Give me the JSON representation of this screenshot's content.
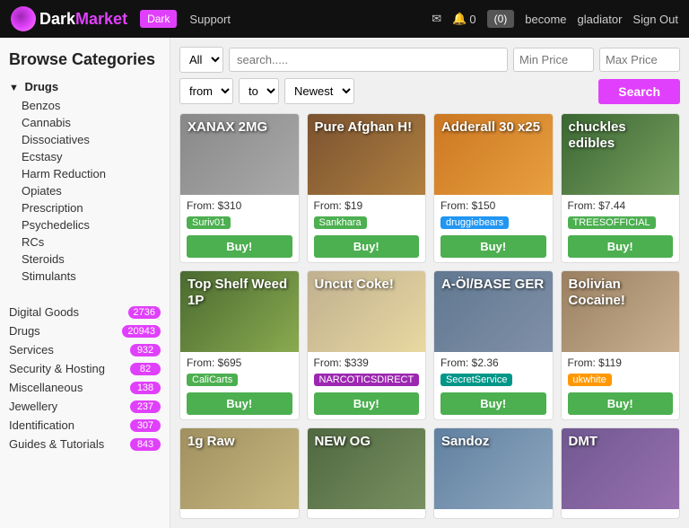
{
  "header": {
    "logo_dark": "Dark",
    "logo_market": "Market",
    "dark_btn": "Dark",
    "support_link": "Support",
    "become_link": "become",
    "user_link": "gladiator",
    "signout_link": "Sign Out",
    "msg_icon": "✉",
    "bell_icon": "🔔",
    "bell_count": "0",
    "cart_btn": "(0)"
  },
  "sidebar": {
    "title": "Browse Categories",
    "drugs_section": "Drugs",
    "sub_items": [
      "Benzos",
      "Cannabis",
      "Dissociatives",
      "Ecstasy",
      "Harm Reduction",
      "Opiates",
      "Prescription",
      "Psychedelics",
      "RCs",
      "Steroids",
      "Stimulants"
    ],
    "categories": [
      {
        "label": "Digital Goods",
        "count": "2736"
      },
      {
        "label": "Drugs",
        "count": "20943"
      },
      {
        "label": "Services",
        "count": "932"
      },
      {
        "label": "Security & Hosting",
        "count": "82"
      },
      {
        "label": "Miscellaneous",
        "count": "138"
      },
      {
        "label": "Jewellery",
        "count": "237"
      },
      {
        "label": "Identification",
        "count": "307"
      },
      {
        "label": "Guides & Tutorials",
        "count": "843"
      }
    ]
  },
  "search": {
    "category_default": "All",
    "search_placeholder": "search.....",
    "min_price_placeholder": "Min Price",
    "max_price_placeholder": "Max Price",
    "from_default": "from",
    "to_default": "to",
    "sort_default": "Newest",
    "search_btn": "Search"
  },
  "products": [
    {
      "title": "XANAX 2MG",
      "price": "From: $310",
      "seller": "Suriv01",
      "seller_color": "seller-green",
      "buy_label": "Buy!",
      "buy_color": "green",
      "bg": "bg-pills"
    },
    {
      "title": "Pure Afghan H!",
      "price": "From: $19",
      "seller": "Sankhara",
      "seller_color": "seller-green",
      "buy_label": "Buy!",
      "buy_color": "green",
      "bg": "bg-brown"
    },
    {
      "title": "Adderall 30 x25",
      "price": "From: $150",
      "seller": "druggiebears",
      "seller_color": "seller-blue",
      "buy_label": "Buy!",
      "buy_color": "green",
      "bg": "bg-orange"
    },
    {
      "title": "chuckles edibles",
      "price": "From: $7.44",
      "seller": "TREESOFFICIAL",
      "seller_color": "seller-green",
      "buy_label": "Buy!",
      "buy_color": "green",
      "bg": "bg-green"
    },
    {
      "title": "Top Shelf Weed 1P",
      "price": "From: $695",
      "seller": "CaliCarts",
      "seller_color": "seller-green",
      "buy_label": "Buy!",
      "buy_color": "green",
      "bg": "bg-weed"
    },
    {
      "title": "Uncut Coke!",
      "price": "From: $339",
      "seller": "NARCOTICSDIRECT",
      "seller_color": "seller-purple",
      "buy_label": "Buy!",
      "buy_color": "green",
      "bg": "bg-coke"
    },
    {
      "title": "A-Öl/BASE GER",
      "price": "From: $2.36",
      "seller": "SecretService",
      "seller_color": "seller-teal",
      "buy_label": "Buy!",
      "buy_color": "green",
      "bg": "bg-ger"
    },
    {
      "title": "Bolivian Cocaine!",
      "price": "From: $119",
      "seller": "ukwhite",
      "seller_color": "seller-orange",
      "buy_label": "Buy!",
      "buy_color": "green",
      "bg": "bg-bolivian"
    },
    {
      "title": "1g Raw",
      "price": "",
      "seller": "",
      "seller_color": "",
      "buy_label": "",
      "buy_color": "",
      "bg": "bg-raw"
    },
    {
      "title": "NEW OG",
      "price": "",
      "seller": "",
      "seller_color": "",
      "buy_label": "",
      "buy_color": "",
      "bg": "bg-og"
    },
    {
      "title": "Sandoz",
      "price": "",
      "seller": "",
      "seller_color": "",
      "buy_label": "",
      "buy_color": "",
      "bg": "bg-sandoz"
    },
    {
      "title": "DMT",
      "price": "",
      "seller": "",
      "seller_color": "",
      "buy_label": "",
      "buy_color": "",
      "bg": "bg-dmt"
    }
  ]
}
